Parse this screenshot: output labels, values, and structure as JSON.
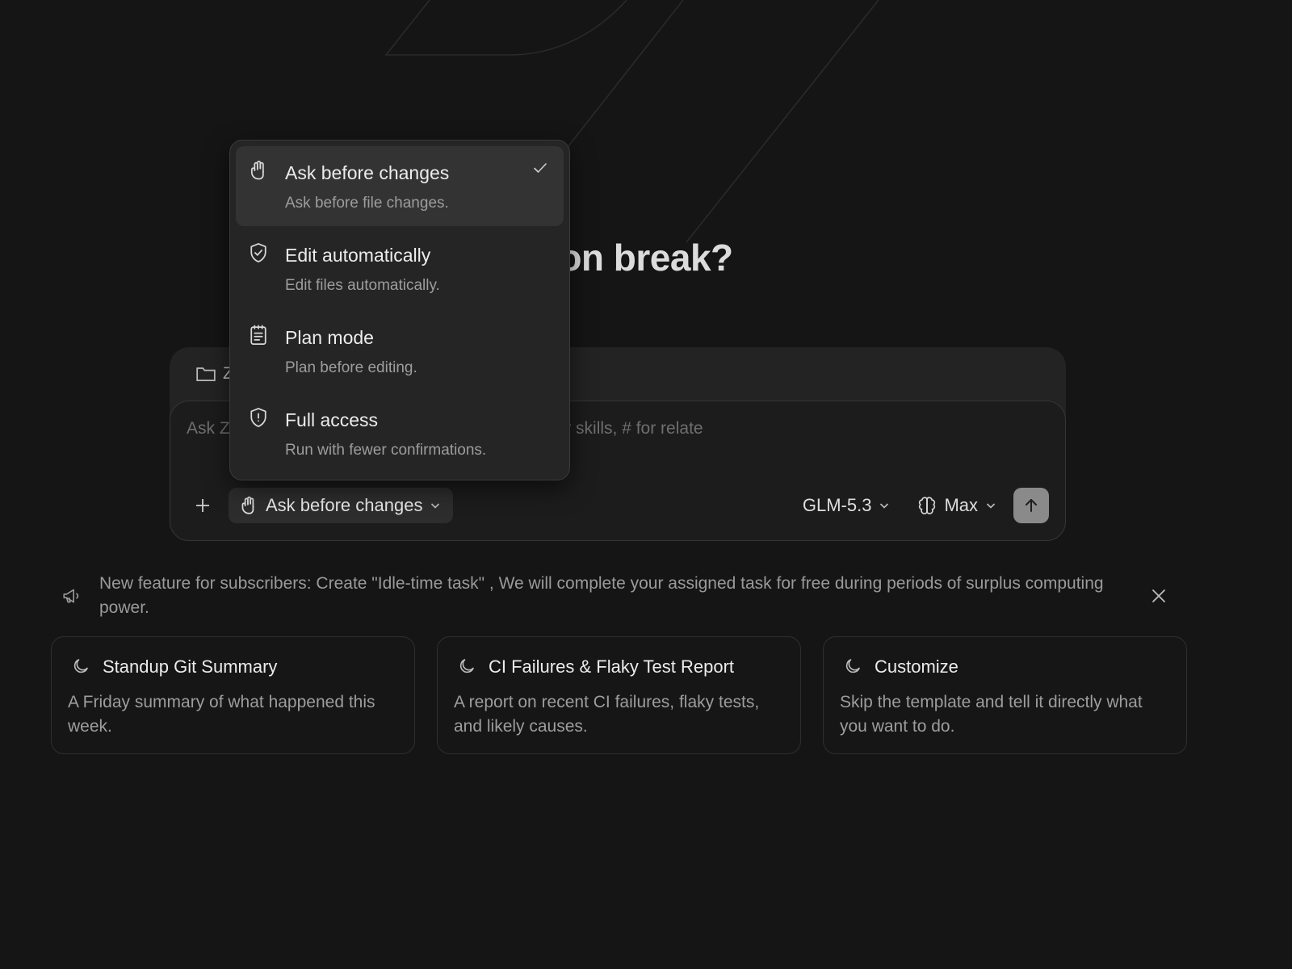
{
  "headline": "on break?",
  "folder": {
    "label": "Z"
  },
  "input": {
    "placeholder": "Ask Z                                      whiteboards, / for commands or agents, $ for skills, # for relate"
  },
  "toolbar": {
    "plus_label": "+",
    "mode_label": "Ask before changes",
    "model_label": "GLM-5.3",
    "effort_label": "Max"
  },
  "mode_menu": {
    "items": [
      {
        "title": "Ask before changes",
        "desc": "Ask before file changes.",
        "icon": "hand-icon",
        "selected": true
      },
      {
        "title": "Edit automatically",
        "desc": "Edit files automatically.",
        "icon": "shield-check-icon",
        "selected": false
      },
      {
        "title": "Plan mode",
        "desc": "Plan before editing.",
        "icon": "clipboard-list-icon",
        "selected": false
      },
      {
        "title": "Full access",
        "desc": "Run with fewer confirmations.",
        "icon": "shield-alert-icon",
        "selected": false
      }
    ]
  },
  "announcement": {
    "text": "New feature for subscribers: Create \"Idle-time task\" , We will complete your assigned task for free during periods of surplus computing power."
  },
  "cards": [
    {
      "title": "Standup Git Summary",
      "desc": "A Friday summary of what happened this week.",
      "icon": "moon-icon"
    },
    {
      "title": "CI Failures & Flaky Test Report",
      "desc": "A report on recent CI failures, flaky tests, and likely causes.",
      "icon": "moon-icon"
    },
    {
      "title": "Customize",
      "desc": "Skip the template and tell it directly what you want to do.",
      "icon": "moon-icon"
    }
  ],
  "colors": {
    "background": "#151515",
    "menu_background": "#252525",
    "selected_item": "#333333",
    "send_button": "#8a8a8a"
  }
}
